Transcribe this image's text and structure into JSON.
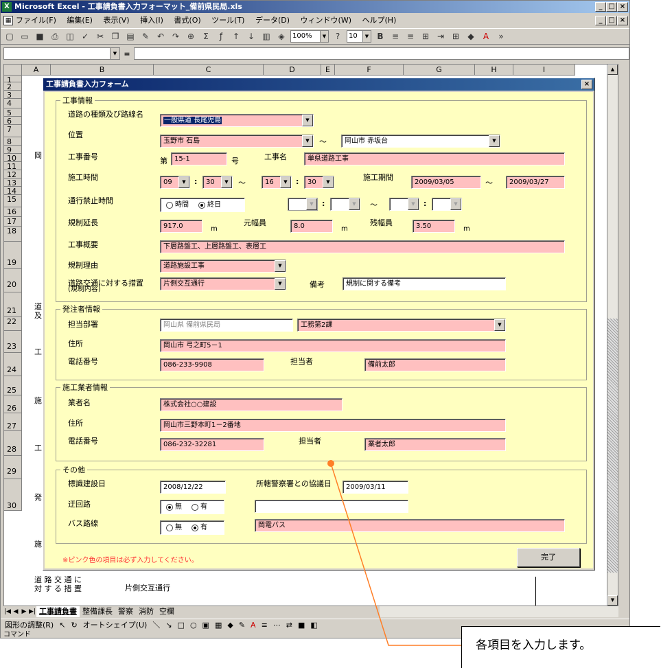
{
  "window": {
    "title": "Microsoft Excel - 工事請負書入力フォーマット_備前県民局.xls",
    "app_icon": "excel-icon",
    "btn_min": "_",
    "btn_max": "□",
    "btn_close": "×"
  },
  "menubar": {
    "items": [
      "ファイル(F)",
      "編集(E)",
      "表示(V)",
      "挿入(I)",
      "書式(O)",
      "ツール(T)",
      "データ(D)",
      "ウィンドウ(W)",
      "ヘルプ(H)"
    ]
  },
  "toolbar": {
    "zoom": "100%",
    "fontsize": "10",
    "bold": "B"
  },
  "formula": {
    "eq": "="
  },
  "grid": {
    "columns": [
      "A",
      "B",
      "C",
      "D",
      "E",
      "F",
      "G",
      "H",
      "I"
    ],
    "rows": [
      "1",
      "2",
      "3",
      "4",
      "5",
      "6",
      "7",
      "8",
      "9",
      "10",
      "11",
      "12",
      "13",
      "14",
      "15",
      "16",
      "17",
      "18",
      "19",
      "20",
      "21",
      "22",
      "23",
      "24",
      "25",
      "26",
      "27",
      "28",
      "29",
      "30"
    ],
    "bg_text_1": "岡",
    "bg_text_2": "道\n及",
    "bg_text_3": "工",
    "bg_text_4": "施",
    "bg_text_5": "工",
    "bg_text_6": "発",
    "bg_text_7": "施",
    "bottom_label": "道 路 交 通 に\n対 す る 措 置",
    "bottom_value": "片側交互通行"
  },
  "sheet_tabs": [
    "工事請負書",
    "整備課長",
    "警察",
    "消防",
    "空欄"
  ],
  "drawbar": {
    "adjust": "図形の調整(R)",
    "autoshape": "オートシェイプ(U)"
  },
  "statusbar": {
    "text": "コマンド"
  },
  "dialog": {
    "title": "工事請負書入力フォーム",
    "close": "×",
    "sections": {
      "construction": "工事情報",
      "orderer": "発注者情報",
      "contractor": "施工業者情報",
      "other": "その他"
    },
    "construction": {
      "road_label": "道路の種類及び路線名",
      "road_value": "一般県道 長尾児島",
      "location_label": "位置",
      "location_from": "玉野市 石島",
      "tilde": "～",
      "location_to": "岡山市 赤坂台",
      "number_label": "工事番号",
      "number_prefix": "第",
      "number_value": "15-1",
      "number_suffix": "号",
      "name_label": "工事名",
      "name_value": "単県道路工事",
      "time_label": "施工時間",
      "time_h1": "09",
      "time_m1": "30",
      "time_h2": "16",
      "time_m2": "30",
      "colon": ":",
      "period_label": "施工期間",
      "period_from": "2009/03/05",
      "period_to": "2009/03/27",
      "closed_label": "通行禁止時間",
      "radio_hours": "時間",
      "radio_allday": "終日",
      "limit_label": "規制延長",
      "limit_value": "917.0",
      "unit_m": "m",
      "width_label": "元幅員",
      "width_value": "8.0",
      "remain_label": "残幅員",
      "remain_value": "3.50",
      "summary_label": "工事概要",
      "summary_value": "下層路盤工、上層路盤工、表層工",
      "reason_label": "規制理由",
      "reason_value": "道路施設工事",
      "measure_label": "道路交通に対する措置",
      "measure_sub": "(規制内容)",
      "measure_value": "片側交互通行",
      "remarks_label": "備考",
      "remarks_value": "規制に関する備考"
    },
    "orderer": {
      "dept_label": "担当部署",
      "dept_value": "岡山県 備前県民局",
      "section_value": "工務第2課",
      "address_label": "住所",
      "address_value": "岡山市 弓之町5－1",
      "phone_label": "電話番号",
      "phone_value": "086-233-9908",
      "person_label": "担当者",
      "person_value": "備前太郎"
    },
    "contractor": {
      "company_label": "業者名",
      "company_value": "株式会社○○建設",
      "address_label": "住所",
      "address_value": "岡山市三野本町1－2番地",
      "phone_label": "電話番号",
      "phone_value": "086-232-32281",
      "person_label": "担当者",
      "person_value": "業者太郎"
    },
    "other": {
      "sign_label": "標識建設日",
      "sign_value": "2008/12/22",
      "police_label": "所轄警察署との協議日",
      "police_value": "2009/03/11",
      "detour_label": "迂回路",
      "radio_none": "無",
      "radio_yes": "有",
      "detour_value": "",
      "bus_label": "バス路線",
      "bus_value": "岡電バス"
    },
    "note": "※ピンク色の項目は必ず入力してください。",
    "done_button": "完了"
  },
  "callout": {
    "text": "各項目を入力します。"
  },
  "colors": {
    "required_field": "#ffc0c0",
    "form_bg": "#ffffc0",
    "pointer": "#ff7f27"
  }
}
